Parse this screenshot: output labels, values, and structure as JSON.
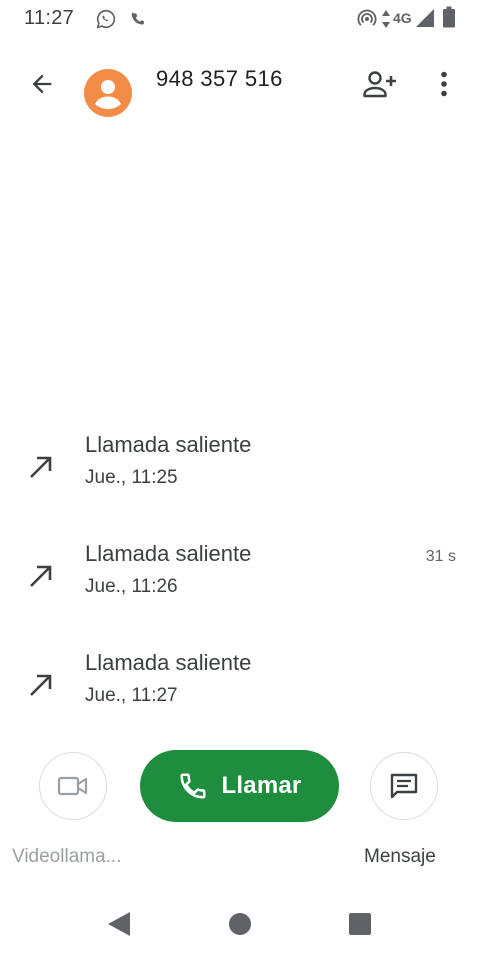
{
  "status_bar": {
    "time": "11:27",
    "network": "4G",
    "icons": [
      "whatsapp-icon",
      "phone-icon",
      "hotspot-icon",
      "data-arrows-icon",
      "signal-icon",
      "battery-icon"
    ]
  },
  "header": {
    "title": "948 357 516",
    "icons": [
      "back-arrow-icon",
      "avatar-person-icon",
      "add-contact-icon",
      "more-vert-icon"
    ]
  },
  "call_log": [
    {
      "type": "Llamada saliente",
      "time": "Jue., 11:25",
      "duration": ""
    },
    {
      "type": "Llamada saliente",
      "time": "Jue., 11:26",
      "duration": "31 s"
    },
    {
      "type": "Llamada saliente",
      "time": "Jue., 11:27",
      "duration": ""
    }
  ],
  "actions": {
    "video_label": "Videollama...",
    "call_label": "Llamar",
    "message_label": "Mensaje"
  },
  "colors": {
    "avatar": "#f28c47",
    "call_button": "#1e8e3e",
    "disabled_text": "#9aa0a6",
    "text_primary": "#202124"
  },
  "nav_bar": [
    "nav-back-icon",
    "nav-home-icon",
    "nav-recents-icon"
  ]
}
